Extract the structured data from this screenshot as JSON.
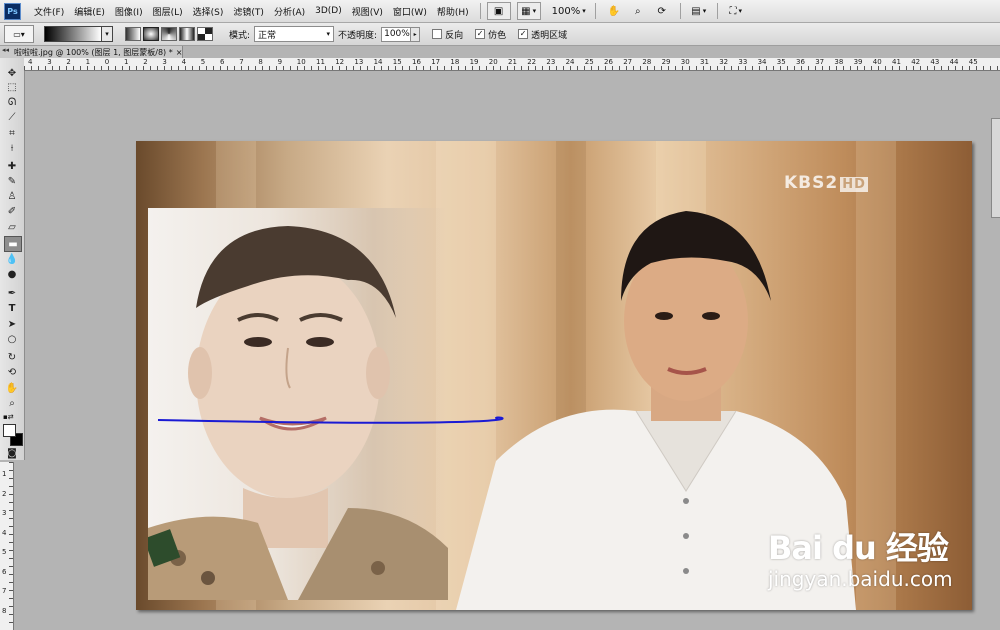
{
  "app": {
    "logo": "Ps"
  },
  "menu": [
    "文件(F)",
    "编辑(E)",
    "图像(I)",
    "图层(L)",
    "选择(S)",
    "滤镜(T)",
    "分析(A)",
    "3D(D)",
    "视图(V)",
    "窗口(W)",
    "帮助(H)"
  ],
  "menubar_tools": {
    "zoom": "100%"
  },
  "options": {
    "mode_label": "模式:",
    "mode_value": "正常",
    "opacity_label": "不透明度:",
    "opacity_value": "100%",
    "reverse_label": "反向",
    "reverse_checked": false,
    "dither_label": "仿色",
    "dither_checked": true,
    "transparency_label": "透明区域",
    "transparency_checked": true
  },
  "document": {
    "tab_title": "啦啦啦.jpg @ 100% (图层 1, 图层蒙板/8) *",
    "close_label": "×"
  },
  "icons": {
    "move": "move-icon",
    "marquee": "marquee-icon",
    "lasso": "lasso-icon",
    "quick_select": "quick-select-icon",
    "crop": "crop-icon",
    "eyedropper": "eyedropper-icon",
    "healing": "healing-brush-icon",
    "brush": "brush-icon",
    "stamp": "clone-stamp-icon",
    "history_brush": "history-brush-icon",
    "eraser": "eraser-icon",
    "gradient": "gradient-icon",
    "blur": "blur-icon",
    "dodge": "dodge-icon",
    "pen": "pen-icon",
    "type": "type-icon",
    "path_select": "path-select-icon",
    "shape": "shape-icon",
    "3d_rotate": "3d-rotate-icon",
    "3d_orbit": "3d-orbit-icon",
    "hand": "hand-icon",
    "zoom": "zoom-icon"
  },
  "h_ruler_labels": [
    "4",
    "3",
    "2",
    "1",
    "0",
    "1",
    "2",
    "3",
    "4",
    "5",
    "6",
    "7",
    "8",
    "9",
    "10",
    "11",
    "12",
    "13",
    "14",
    "15",
    "16",
    "17",
    "18",
    "19",
    "20",
    "21",
    "22",
    "23",
    "24",
    "25",
    "26",
    "27",
    "28",
    "29",
    "30",
    "31",
    "32",
    "33",
    "34",
    "35",
    "36",
    "37",
    "38",
    "39",
    "40",
    "41",
    "42",
    "43",
    "44",
    "45"
  ],
  "v_ruler_labels": [
    "1",
    "2",
    "3",
    "4",
    "5",
    "6",
    "7",
    "8"
  ],
  "canvas": {
    "broadcaster_logo": "KBS2",
    "broadcaster_hd": "HD",
    "watermark_brand": "Bai du 经验",
    "watermark_url": "jingyan.baidu.com",
    "stroke_color": "#1a1ad4"
  },
  "colors": {
    "foreground": "#ffffff",
    "background": "#000000"
  }
}
